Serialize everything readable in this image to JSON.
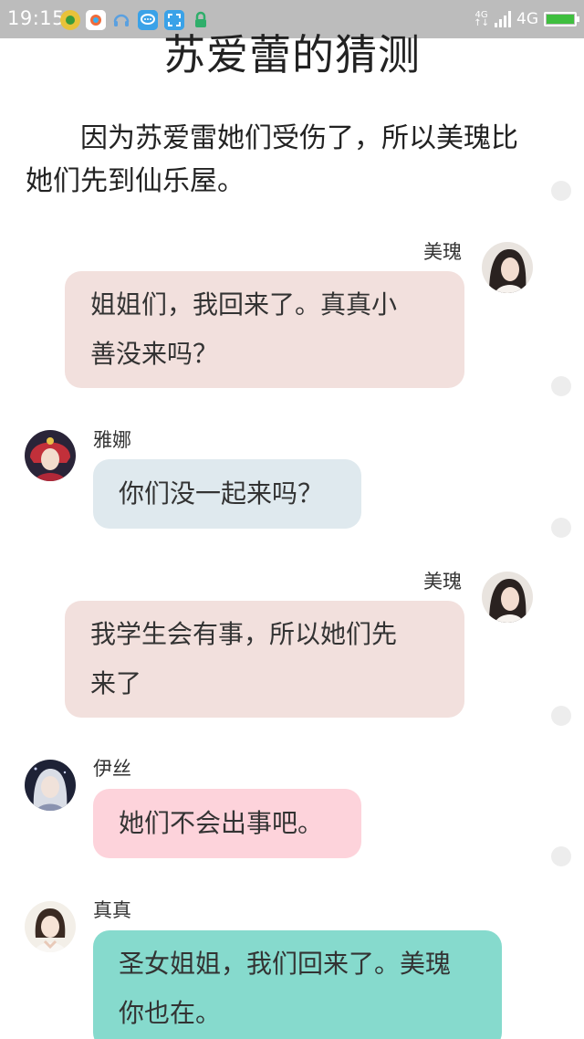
{
  "status_bar": {
    "time": "19:15",
    "network_small": "4G",
    "network_label": "4G",
    "icons": [
      "wallet-app-icon",
      "browser-app-icon",
      "headset-icon",
      "chat-app-icon",
      "scan-app-icon",
      "lock-icon"
    ]
  },
  "article": {
    "title": "苏爱蕾的猜测",
    "narration": "因为苏爱雷她们受伤了，所以美瑰比她们先到仙乐屋。"
  },
  "messages": [
    {
      "speaker": "美瑰",
      "text_lines": [
        "姐姐们，我回来了。真真小",
        "善没来吗？"
      ],
      "side": "right",
      "bubble_color": "#f2e0dd"
    },
    {
      "speaker": "雅娜",
      "text_lines": [
        "你们没一起来吗？"
      ],
      "side": "left",
      "bubble_color": "#dfe9ee"
    },
    {
      "speaker": "美瑰",
      "text_lines": [
        "我学生会有事，所以她们先",
        "来了"
      ],
      "side": "right",
      "bubble_color": "#f2e0dd"
    },
    {
      "speaker": "伊丝",
      "text_lines": [
        "她们不会出事吧。"
      ],
      "side": "left",
      "bubble_color": "#fdd3db"
    },
    {
      "speaker": "真真",
      "text_lines": [
        "圣女姐姐，我们回来了。美瑰",
        "你也在。"
      ],
      "side": "left",
      "bubble_color": "#86dacd"
    }
  ]
}
